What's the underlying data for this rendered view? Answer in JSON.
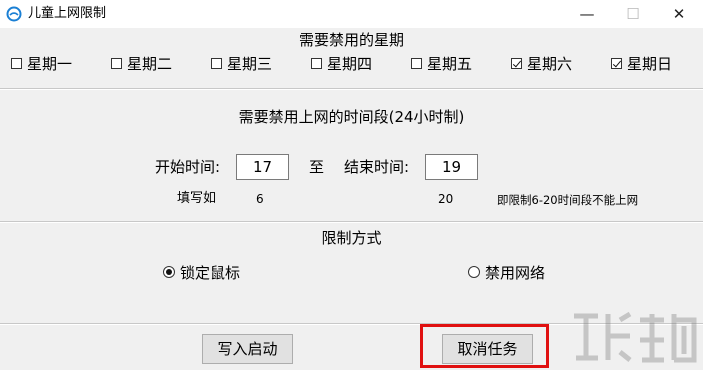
{
  "window": {
    "title": "儿童上网限制",
    "minimize_glyph": "—",
    "maximize_glyph": "☐",
    "close_glyph": "✕",
    "icon": "app-logo-icon"
  },
  "weekdays": {
    "title": "需要禁用的星期",
    "items": [
      {
        "label": "星期一",
        "checked": false
      },
      {
        "label": "星期二",
        "checked": false
      },
      {
        "label": "星期三",
        "checked": false
      },
      {
        "label": "星期四",
        "checked": false
      },
      {
        "label": "星期五",
        "checked": false
      },
      {
        "label": "星期六",
        "checked": true
      },
      {
        "label": "星期日",
        "checked": true
      }
    ]
  },
  "time": {
    "title": "需要禁用上网的时间段(24小时制)",
    "start_label": "开始时间:",
    "start_value": "17",
    "to_label": "至",
    "end_label": "结束时间:",
    "end_value": "19",
    "example_label": "填写如",
    "example_start": "6",
    "example_end": "20",
    "example_note": "即限制6-20时间段不能上网"
  },
  "mode": {
    "title": "限制方式",
    "options": [
      {
        "label": "锁定鼠标",
        "selected": true
      },
      {
        "label": "禁用网络",
        "selected": false
      }
    ]
  },
  "buttons": {
    "write_startup": "写入启动",
    "cancel_task": "取消任务"
  },
  "colors": {
    "highlight": "#e01010",
    "background": "#f0f0f0"
  }
}
